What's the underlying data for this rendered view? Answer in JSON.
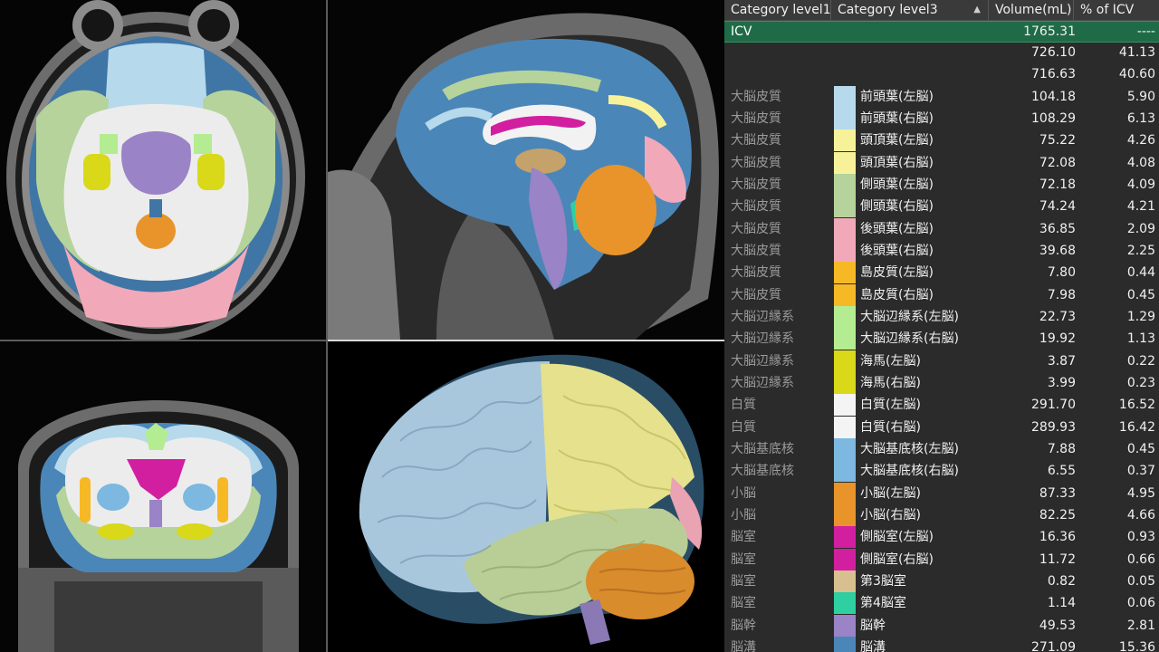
{
  "table": {
    "columns": [
      "Category level1",
      "Category level3",
      "Volume(mL)",
      "% of ICV"
    ],
    "rows": [
      {
        "lv1": "ICV",
        "lv3": "",
        "vol": "1765.31",
        "pct": "----",
        "color": "",
        "highlight": true
      },
      {
        "lv1": "",
        "lv3": "",
        "vol": "726.10",
        "pct": "41.13",
        "color": ""
      },
      {
        "lv1": "",
        "lv3": "",
        "vol": "716.63",
        "pct": "40.60",
        "color": ""
      },
      {
        "lv1": "大脳皮質",
        "lv3": "前頭葉(左脳)",
        "vol": "104.18",
        "pct": "5.90",
        "color": "#b7d9ec"
      },
      {
        "lv1": "大脳皮質",
        "lv3": "前頭葉(右脳)",
        "vol": "108.29",
        "pct": "6.13",
        "color": "#b7d9ec"
      },
      {
        "lv1": "大脳皮質",
        "lv3": "頭頂葉(左脳)",
        "vol": "75.22",
        "pct": "4.26",
        "color": "#f7f29a"
      },
      {
        "lv1": "大脳皮質",
        "lv3": "頭頂葉(右脳)",
        "vol": "72.08",
        "pct": "4.08",
        "color": "#f7f29a"
      },
      {
        "lv1": "大脳皮質",
        "lv3": "側頭葉(左脳)",
        "vol": "72.18",
        "pct": "4.09",
        "color": "#b5d39b"
      },
      {
        "lv1": "大脳皮質",
        "lv3": "側頭葉(右脳)",
        "vol": "74.24",
        "pct": "4.21",
        "color": "#b5d39b"
      },
      {
        "lv1": "大脳皮質",
        "lv3": "後頭葉(左脳)",
        "vol": "36.85",
        "pct": "2.09",
        "color": "#f1a9b9"
      },
      {
        "lv1": "大脳皮質",
        "lv3": "後頭葉(右脳)",
        "vol": "39.68",
        "pct": "2.25",
        "color": "#f1a9b9"
      },
      {
        "lv1": "大脳皮質",
        "lv3": "島皮質(左脳)",
        "vol": "7.80",
        "pct": "0.44",
        "color": "#f6b925"
      },
      {
        "lv1": "大脳皮質",
        "lv3": "島皮質(右脳)",
        "vol": "7.98",
        "pct": "0.45",
        "color": "#f6b925"
      },
      {
        "lv1": "大脳辺縁系",
        "lv3": "大脳辺縁系(左脳)",
        "vol": "22.73",
        "pct": "1.29",
        "color": "#b4ec92"
      },
      {
        "lv1": "大脳辺縁系",
        "lv3": "大脳辺縁系(右脳)",
        "vol": "19.92",
        "pct": "1.13",
        "color": "#b4ec92"
      },
      {
        "lv1": "大脳辺縁系",
        "lv3": "海馬(左脳)",
        "vol": "3.87",
        "pct": "0.22",
        "color": "#d9d819"
      },
      {
        "lv1": "大脳辺縁系",
        "lv3": "海馬(右脳)",
        "vol": "3.99",
        "pct": "0.23",
        "color": "#d9d819"
      },
      {
        "lv1": "白質",
        "lv3": "白質(左脳)",
        "vol": "291.70",
        "pct": "16.52",
        "color": "#f4f4f4"
      },
      {
        "lv1": "白質",
        "lv3": "白質(右脳)",
        "vol": "289.93",
        "pct": "16.42",
        "color": "#f4f4f4"
      },
      {
        "lv1": "大脳基底核",
        "lv3": "大脳基底核(左脳)",
        "vol": "7.88",
        "pct": "0.45",
        "color": "#7cb8df"
      },
      {
        "lv1": "大脳基底核",
        "lv3": "大脳基底核(右脳)",
        "vol": "6.55",
        "pct": "0.37",
        "color": "#7cb8df"
      },
      {
        "lv1": "小脳",
        "lv3": "小脳(左脳)",
        "vol": "87.33",
        "pct": "4.95",
        "color": "#e8942a"
      },
      {
        "lv1": "小脳",
        "lv3": "小脳(右脳)",
        "vol": "82.25",
        "pct": "4.66",
        "color": "#e8942a"
      },
      {
        "lv1": "脳室",
        "lv3": "側脳室(左脳)",
        "vol": "16.36",
        "pct": "0.93",
        "color": "#d21fa0"
      },
      {
        "lv1": "脳室",
        "lv3": "側脳室(右脳)",
        "vol": "11.72",
        "pct": "0.66",
        "color": "#d21fa0"
      },
      {
        "lv1": "脳室",
        "lv3": "第3脳室",
        "vol": "0.82",
        "pct": "0.05",
        "color": "#d8bf8f"
      },
      {
        "lv1": "脳室",
        "lv3": "第4脳室",
        "vol": "1.14",
        "pct": "0.06",
        "color": "#2ecfa0"
      },
      {
        "lv1": "脳幹",
        "lv3": "脳幹",
        "vol": "49.53",
        "pct": "2.81",
        "color": "#9a83c6"
      },
      {
        "lv1": "脳溝",
        "lv3": "脳溝",
        "vol": "271.09",
        "pct": "15.36",
        "color": "#4b86b8"
      }
    ]
  }
}
